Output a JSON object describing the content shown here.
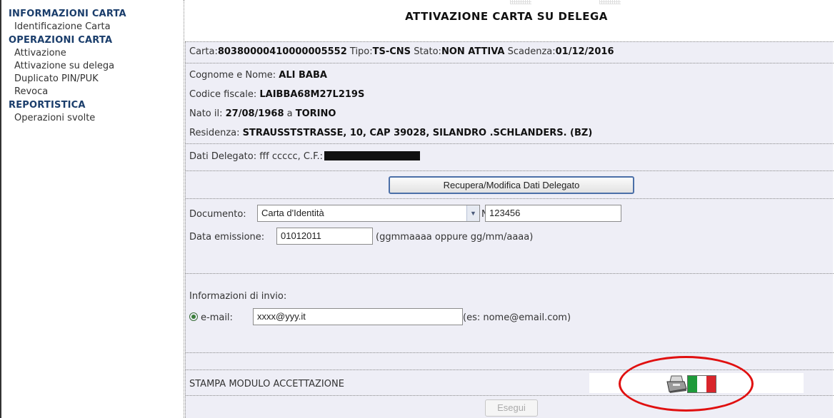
{
  "sidebar": {
    "sections": [
      {
        "title": "INFORMAZIONI CARTA",
        "items": [
          "Identificazione Carta"
        ]
      },
      {
        "title": "OPERAZIONI CARTA",
        "items": [
          "Attivazione",
          "Attivazione su delega",
          "Duplicato PIN/PUK",
          "Revoca"
        ]
      },
      {
        "title": "REPORTISTICA",
        "items": [
          "Operazioni svolte"
        ]
      }
    ]
  },
  "page": {
    "title": "ATTIVAZIONE CARTA SU DELEGA"
  },
  "card": {
    "carta_label": "Carta:",
    "carta_value": "80380000410000005552",
    "tipo_label": " Tipo:",
    "tipo_value": "TS-CNS",
    "stato_label": " Stato:",
    "stato_value": "NON ATTIVA",
    "scadenza_label": " Scadenza:",
    "scadenza_value": "01/12/2016"
  },
  "holder": {
    "nome_label": "Cognome e Nome: ",
    "nome_value": "ALI BABA",
    "cf_label": "Codice fiscale: ",
    "cf_value": "LAIBBA68M27L219S",
    "nato_label": "Nato il: ",
    "nato_date": "27/08/1968",
    "nato_mid": " a ",
    "nato_city": "TORINO",
    "res_label": "Residenza: ",
    "res_value": "STRAUSSTSTRASSE, 10, CAP 39028, SILANDRO .SCHLANDERS. (BZ)"
  },
  "delegate": {
    "label": "Dati Delegato: fff ccccc, C.F.:",
    "button": "Recupera/Modifica Dati Delegato"
  },
  "document": {
    "doc_label": "Documento:",
    "doc_selected": "Carta d'Identità",
    "nr_label": "NR:",
    "nr_value": "123456",
    "date_label": "Data emissione:",
    "date_value": "01012011",
    "date_hint": "(ggmmaaaa oppure gg/mm/aaaa)"
  },
  "send": {
    "title": "Informazioni di invio:",
    "email_label": "e-mail:",
    "email_value": "xxxx@yyy.it",
    "email_hint": "(es: nome@email.com)"
  },
  "print": {
    "label": "STAMPA MODULO ACCETTAZIONE"
  },
  "actions": {
    "submit": "Esegui"
  },
  "colors": {
    "flag_green": "#1e9a3a",
    "flag_white": "#ffffff",
    "flag_red": "#d9252b",
    "highlight": "#e01010"
  }
}
